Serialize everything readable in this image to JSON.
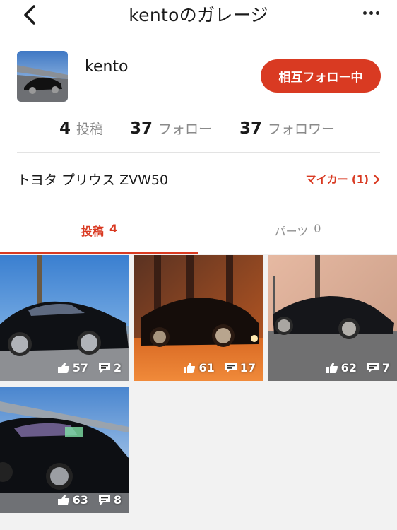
{
  "header": {
    "title": "kentoのガレージ",
    "back_icon": "chevron-left-icon",
    "more_icon": "more-horizontal-icon"
  },
  "profile": {
    "username": "kento",
    "follow_button_label": "相互フォロー中"
  },
  "stats": {
    "posts": {
      "count": "4",
      "label": "投稿"
    },
    "following": {
      "count": "37",
      "label": "フォロー"
    },
    "followers": {
      "count": "37",
      "label": "フォロワー"
    }
  },
  "car": {
    "name": "トヨタ プリウス ZVW50",
    "mycar_label": "マイカー (1)"
  },
  "tabs": [
    {
      "label": "投稿",
      "count": "4",
      "active": true
    },
    {
      "label": "パーツ",
      "count": "0",
      "active": false
    }
  ],
  "posts": [
    {
      "likes": "57",
      "comments": "2"
    },
    {
      "likes": "61",
      "comments": "17"
    },
    {
      "likes": "62",
      "comments": "7"
    },
    {
      "likes": "63",
      "comments": "8"
    }
  ],
  "colors": {
    "accent": "#d93a22",
    "muted": "#8a8a8a",
    "grid_background": "#f2f2f2"
  }
}
